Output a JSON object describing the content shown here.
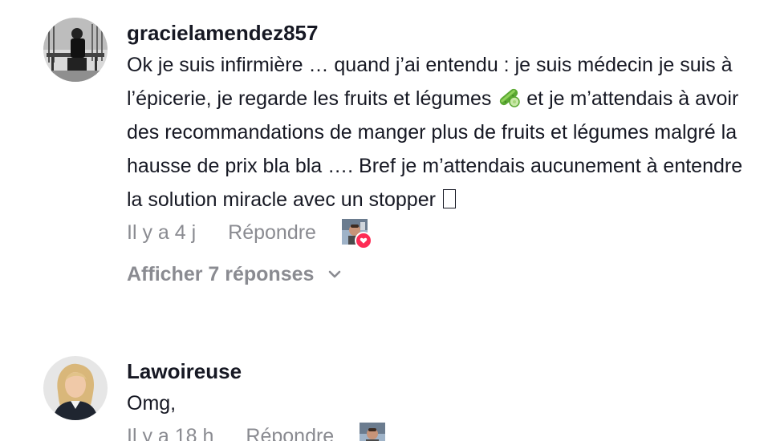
{
  "comments": [
    {
      "username": "gracielamendez857",
      "text_part1": "Ok je suis infirmière … quand j’ai entendu : je suis médecin je suis à l’épicerie, je regarde les fruits et légumes ",
      "text_part2": " et je m’attendais à avoir des recommandations de manger plus de fruits et légumes malgré la hausse de prix bla bla …. Bref je m’attendais aucunement à entendre la solution miracle avec un stopper ",
      "inline_icon": "cucumber-icon",
      "trailing_glyph": "missing-glyph",
      "time": "Il y a 4 j",
      "reply_label": "Répondre",
      "liked_by_creator": true,
      "view_replies_label": "Afficher 7 réponses"
    },
    {
      "username": "Lawoireuse",
      "text": "Omg,",
      "time": "Il y a 18 h",
      "reply_label": "Répondre",
      "liked_by_creator": true
    }
  ],
  "colors": {
    "text": "#161823",
    "secondary": "#8a8b91",
    "like_badge": "#fe2c55"
  }
}
